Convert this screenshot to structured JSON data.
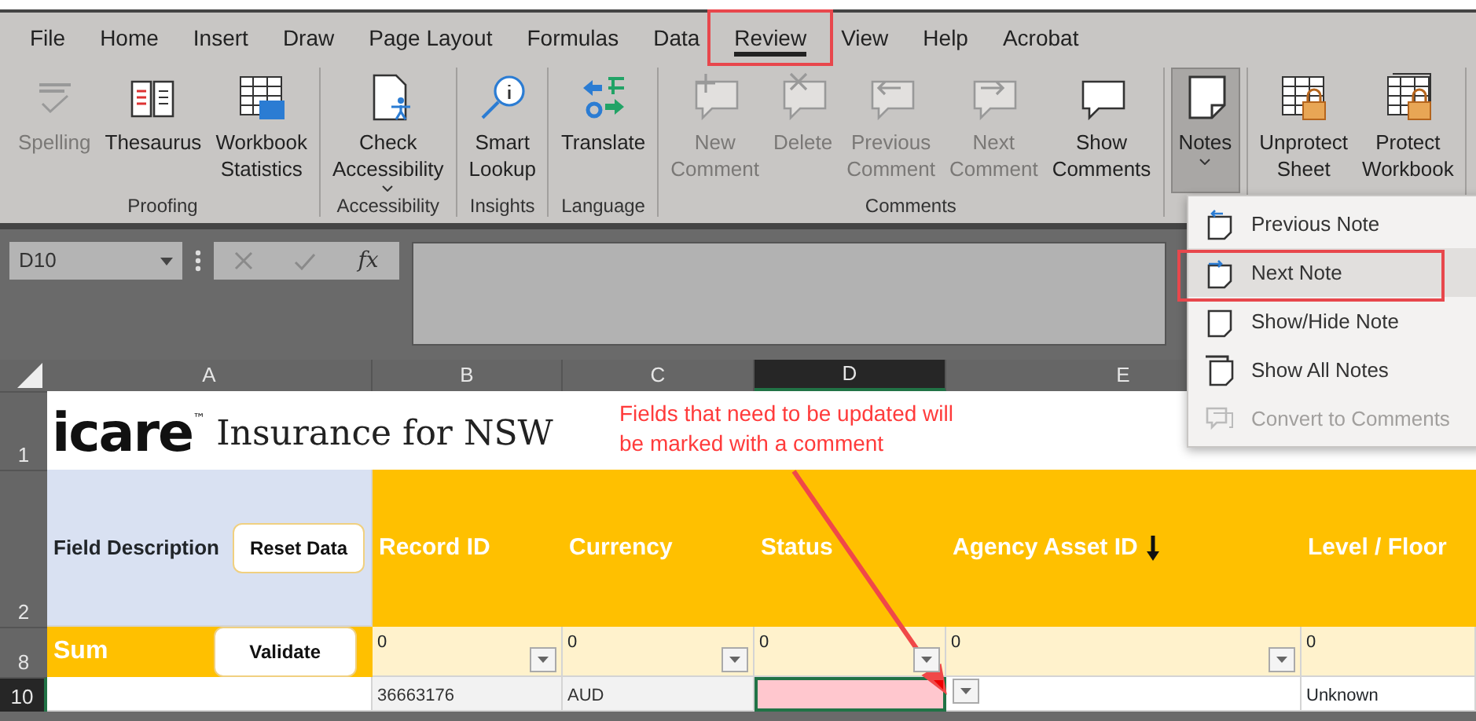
{
  "menu_tabs": [
    {
      "label": "File",
      "selected": false,
      "callout": false
    },
    {
      "label": "Home",
      "selected": false,
      "callout": false
    },
    {
      "label": "Insert",
      "selected": false,
      "callout": false
    },
    {
      "label": "Draw",
      "selected": false,
      "callout": false
    },
    {
      "label": "Page Layout",
      "selected": false,
      "callout": false
    },
    {
      "label": "Formulas",
      "selected": false,
      "callout": false
    },
    {
      "label": "Data",
      "selected": false,
      "callout": false
    },
    {
      "label": "Review",
      "selected": true,
      "callout": true
    },
    {
      "label": "View",
      "selected": false,
      "callout": false
    },
    {
      "label": "Help",
      "selected": false,
      "callout": false
    },
    {
      "label": "Acrobat",
      "selected": false,
      "callout": false
    }
  ],
  "ribbon": [
    {
      "label": "Proofing",
      "buttons": [
        {
          "label": "Spelling",
          "disabled": true
        },
        {
          "label": "Thesaurus",
          "disabled": false
        },
        {
          "label": "Workbook\nStatistics",
          "disabled": false
        }
      ]
    },
    {
      "label": "Accessibility",
      "buttons": [
        {
          "label": "Check\nAccessibility",
          "disabled": false,
          "dropdown": true
        }
      ]
    },
    {
      "label": "Insights",
      "buttons": [
        {
          "label": "Smart\nLookup",
          "disabled": false
        }
      ]
    },
    {
      "label": "Language",
      "buttons": [
        {
          "label": "Translate",
          "disabled": false
        }
      ]
    },
    {
      "label": "Comments",
      "buttons": [
        {
          "label": "New\nComment",
          "disabled": true
        },
        {
          "label": "Delete",
          "disabled": true
        },
        {
          "label": "Previous\nComment",
          "disabled": true
        },
        {
          "label": "Next\nComment",
          "disabled": true
        },
        {
          "label": "Show\nComments",
          "disabled": false
        }
      ]
    },
    {
      "buttons": [
        {
          "label": "Notes",
          "disabled": false,
          "dropdown": true,
          "pressed": true
        }
      ]
    },
    {
      "buttons": [
        {
          "label": "Unprotect\nSheet",
          "disabled": false
        },
        {
          "label": "Protect\nWorkbook",
          "disabled": false
        }
      ]
    }
  ],
  "notes_menu": [
    {
      "label": "Previous Note",
      "disabled": false,
      "hovered": false,
      "callout": false
    },
    {
      "label": "Next Note",
      "disabled": false,
      "hovered": true,
      "callout": true
    },
    {
      "label": "Show/Hide Note",
      "disabled": false,
      "hovered": false,
      "callout": false
    },
    {
      "label": "Show All Notes",
      "disabled": false,
      "hovered": false,
      "callout": false
    },
    {
      "label": "Convert to Comments",
      "disabled": true,
      "hovered": false,
      "callout": false
    }
  ],
  "formula_bar": {
    "name_box": "D10",
    "function_label": "fx"
  },
  "sheet": {
    "columns": [
      {
        "label": "A",
        "selected": false
      },
      {
        "label": "B",
        "selected": false
      },
      {
        "label": "C",
        "selected": false
      },
      {
        "label": "D",
        "selected": true
      },
      {
        "label": "E",
        "selected": false
      }
    ],
    "rows": [
      {
        "header": "1",
        "selected": false,
        "kind": "title",
        "logo": "icare$^{™}$",
        "tagline": "Insurance for NSW",
        "note": "Fields that need to be updated will be marked with a comment"
      },
      {
        "header": "2",
        "selected": false,
        "kind": "headings",
        "label": "Field Description",
        "button": "Reset Data",
        "cells": [
          {
            "text": "Record ID",
            "arrow": false
          },
          {
            "text": "Currency",
            "arrow": false
          },
          {
            "text": "Status",
            "arrow": false
          },
          {
            "text": "Agency Asset ID",
            "arrow": true
          },
          {
            "text": "Level / Floor",
            "arrow": false
          }
        ]
      },
      {
        "header": "8",
        "selected": false,
        "kind": "totals",
        "label": "Sum",
        "button": "Validate",
        "cells": [
          {
            "text": "0",
            "filter": true
          },
          {
            "text": "0",
            "filter": true
          },
          {
            "text": "0",
            "filter": true
          },
          {
            "text": "0",
            "filter": true
          },
          {
            "text": "0",
            "filter": false
          }
        ]
      },
      {
        "header": "10",
        "selected": true,
        "kind": "data",
        "cells": [
          {
            "text": "36663176",
            "shaded": true
          },
          {
            "text": "AUD",
            "shaded": true
          },
          {
            "selected": true,
            "comment": true,
            "dropdown": true
          },
          {
            "selected": false
          },
          {
            "text": "Unknown",
            "shaded": false
          }
        ]
      }
    ]
  }
}
